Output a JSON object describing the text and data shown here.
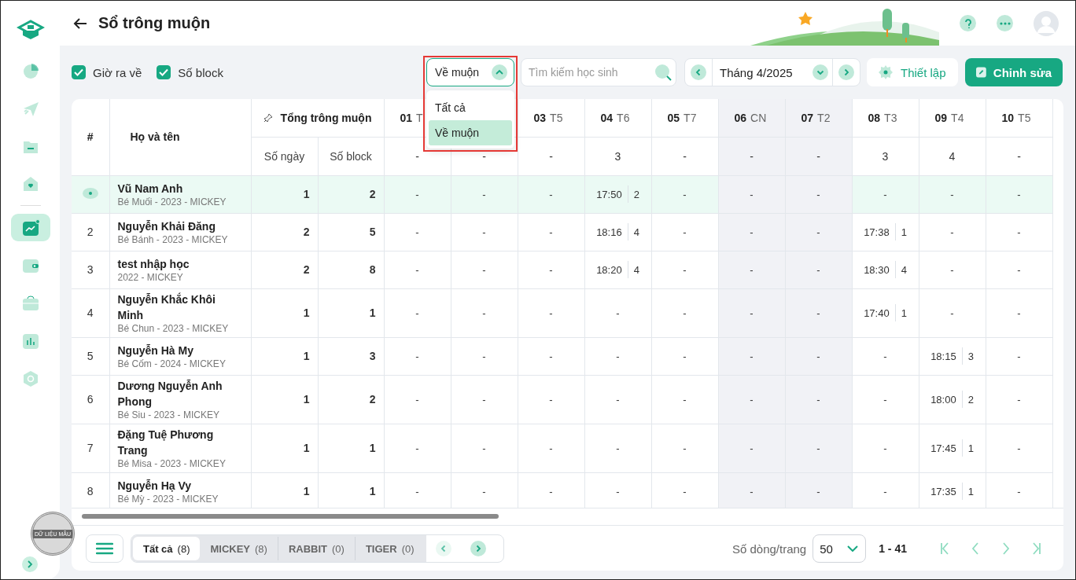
{
  "header": {
    "title": "Sổ trông muộn"
  },
  "sidebar": {
    "groups": [
      [
        {
          "selected": false
        },
        {
          "selected": false
        },
        {
          "selected": false
        },
        {
          "selected": false
        }
      ],
      [
        {
          "selected": true
        },
        {
          "selected": false
        },
        {
          "selected": false
        },
        {
          "selected": false
        },
        {
          "selected": false
        }
      ]
    ]
  },
  "stamp": {
    "text": "DỮ LIỆU MẪU"
  },
  "toolbar": {
    "options": [
      {
        "label": "Giờ ra về",
        "checked": true
      },
      {
        "label": "Số block",
        "checked": true
      }
    ],
    "filter": {
      "value": "Về muộn",
      "open": true,
      "highlighted": true,
      "options": [
        {
          "label": "Tất cả",
          "selected": false
        },
        {
          "label": "Về muộn",
          "selected": true
        }
      ]
    },
    "search": {
      "placeholder": "Tìm kiếm học sinh"
    },
    "month": {
      "label": "Tháng 4/2025"
    },
    "buttons": [
      {
        "label": "Thiết lập",
        "kind": "secondary"
      },
      {
        "label": "Chỉnh sửa",
        "kind": "primary"
      }
    ]
  },
  "table": {
    "columns": {
      "index": "#",
      "name": "Họ và tên",
      "total": "Tổng trông muộn",
      "days_count": "Số ngày",
      "blocks_count": "Số block"
    },
    "days": [
      {
        "day": "01",
        "weekday": "T",
        "off": false,
        "total": "-"
      },
      {
        "off": false,
        "total": "-"
      },
      {
        "day": "03",
        "weekday": "T5",
        "off": false,
        "total": "-"
      },
      {
        "day": "04",
        "weekday": "T6",
        "off": false,
        "total": "3"
      },
      {
        "day": "05",
        "weekday": "T7",
        "off": false,
        "total": "-"
      },
      {
        "day": "06",
        "weekday": "CN",
        "off": true,
        "total": "-"
      },
      {
        "day": "07",
        "weekday": "T2",
        "off": true,
        "total": "-"
      },
      {
        "day": "08",
        "weekday": "T3",
        "off": false,
        "total": "3"
      },
      {
        "day": "09",
        "weekday": "T4",
        "off": false,
        "total": "4"
      },
      {
        "day": "10",
        "weekday": "T5",
        "off": false,
        "total": "-"
      }
    ],
    "rows": [
      {
        "selected": true,
        "name": "Vũ Nam Anh",
        "info": "Bé Muối - 2023 - MICKEY",
        "days": "1",
        "blocks": "2",
        "cells": [
          {
            "kind": "empty",
            "text": "-"
          },
          {
            "kind": "empty",
            "text": "-"
          },
          {
            "kind": "empty",
            "text": "-"
          },
          {
            "kind": "late",
            "time": "17:50",
            "blocks": "2"
          },
          {
            "kind": "empty",
            "text": "-"
          },
          {
            "kind": "empty",
            "text": "-"
          },
          {
            "kind": "empty",
            "text": "-"
          },
          {
            "kind": "empty",
            "text": "-"
          },
          {
            "kind": "empty",
            "text": "-"
          },
          {
            "kind": "empty",
            "text": "-"
          }
        ]
      },
      {
        "selected": false,
        "index": "2",
        "name": "Nguyễn Khải Đăng",
        "info": "Bé Bánh - 2023 - MICKEY",
        "days": "2",
        "blocks": "5",
        "cells": [
          {
            "kind": "empty",
            "text": "-"
          },
          {
            "kind": "empty",
            "text": "-"
          },
          {
            "kind": "empty",
            "text": "-"
          },
          {
            "kind": "late",
            "time": "18:16",
            "blocks": "4"
          },
          {
            "kind": "empty",
            "text": "-"
          },
          {
            "kind": "empty",
            "text": "-"
          },
          {
            "kind": "empty",
            "text": "-"
          },
          {
            "kind": "late",
            "time": "17:38",
            "blocks": "1"
          },
          {
            "kind": "empty",
            "text": "-"
          },
          {
            "kind": "empty",
            "text": "-"
          }
        ]
      },
      {
        "selected": false,
        "index": "3",
        "name": "test nhập học",
        "info": "2022 - MICKEY",
        "days": "2",
        "blocks": "8",
        "cells": [
          {
            "kind": "empty",
            "text": "-"
          },
          {
            "kind": "empty",
            "text": "-"
          },
          {
            "kind": "empty",
            "text": "-"
          },
          {
            "kind": "late",
            "time": "18:20",
            "blocks": "4"
          },
          {
            "kind": "empty",
            "text": "-"
          },
          {
            "kind": "empty",
            "text": "-"
          },
          {
            "kind": "empty",
            "text": "-"
          },
          {
            "kind": "late",
            "time": "18:30",
            "blocks": "4"
          },
          {
            "kind": "empty",
            "text": "-"
          },
          {
            "kind": "empty",
            "text": "-"
          }
        ]
      },
      {
        "selected": false,
        "index": "4",
        "name": "Nguyễn Khắc Khôi Minh",
        "info": "Bé Chun - 2023 - MICKEY",
        "days": "1",
        "blocks": "1",
        "cells": [
          {
            "kind": "empty",
            "text": "-"
          },
          {
            "kind": "empty",
            "text": "-"
          },
          {
            "kind": "empty",
            "text": "-"
          },
          {
            "kind": "empty",
            "text": "-"
          },
          {
            "kind": "empty",
            "text": "-"
          },
          {
            "kind": "empty",
            "text": "-"
          },
          {
            "kind": "empty",
            "text": "-"
          },
          {
            "kind": "late",
            "time": "17:40",
            "blocks": "1"
          },
          {
            "kind": "empty",
            "text": "-"
          },
          {
            "kind": "empty",
            "text": "-"
          }
        ]
      },
      {
        "selected": false,
        "index": "5",
        "name": "Nguyễn Hà My",
        "info": "Bé Cốm - 2024 - MICKEY",
        "days": "1",
        "blocks": "3",
        "cells": [
          {
            "kind": "empty",
            "text": "-"
          },
          {
            "kind": "empty",
            "text": "-"
          },
          {
            "kind": "empty",
            "text": "-"
          },
          {
            "kind": "empty",
            "text": "-"
          },
          {
            "kind": "empty",
            "text": "-"
          },
          {
            "kind": "empty",
            "text": "-"
          },
          {
            "kind": "empty",
            "text": "-"
          },
          {
            "kind": "empty",
            "text": "-"
          },
          {
            "kind": "late",
            "time": "18:15",
            "blocks": "3"
          },
          {
            "kind": "empty",
            "text": "-"
          }
        ]
      },
      {
        "selected": false,
        "index": "6",
        "name": "Dương Nguyễn Anh Phong",
        "info": "Bé Siu - 2023 - MICKEY",
        "days": "1",
        "blocks": "2",
        "cells": [
          {
            "kind": "empty",
            "text": "-"
          },
          {
            "kind": "empty",
            "text": "-"
          },
          {
            "kind": "empty",
            "text": "-"
          },
          {
            "kind": "empty",
            "text": "-"
          },
          {
            "kind": "empty",
            "text": "-"
          },
          {
            "kind": "empty",
            "text": "-"
          },
          {
            "kind": "empty",
            "text": "-"
          },
          {
            "kind": "empty",
            "text": "-"
          },
          {
            "kind": "late",
            "time": "18:00",
            "blocks": "2"
          },
          {
            "kind": "empty",
            "text": "-"
          }
        ]
      },
      {
        "selected": false,
        "index": "7",
        "name": "Đặng Tuệ Phương Trang",
        "info": "Bé Misa - 2023 - MICKEY",
        "days": "1",
        "blocks": "1",
        "cells": [
          {
            "kind": "empty",
            "text": "-"
          },
          {
            "kind": "empty",
            "text": "-"
          },
          {
            "kind": "empty",
            "text": "-"
          },
          {
            "kind": "empty",
            "text": "-"
          },
          {
            "kind": "empty",
            "text": "-"
          },
          {
            "kind": "empty",
            "text": "-"
          },
          {
            "kind": "empty",
            "text": "-"
          },
          {
            "kind": "empty",
            "text": "-"
          },
          {
            "kind": "late",
            "time": "17:45",
            "blocks": "1"
          },
          {
            "kind": "empty",
            "text": "-"
          }
        ]
      },
      {
        "selected": false,
        "index": "8",
        "name": "Nguyễn Hạ Vy",
        "info": "Bé Mỳ - 2023 - MICKEY",
        "days": "1",
        "blocks": "1",
        "cells": [
          {
            "kind": "empty",
            "text": "-"
          },
          {
            "kind": "empty",
            "text": "-"
          },
          {
            "kind": "empty",
            "text": "-"
          },
          {
            "kind": "empty",
            "text": "-"
          },
          {
            "kind": "empty",
            "text": "-"
          },
          {
            "kind": "empty",
            "text": "-"
          },
          {
            "kind": "empty",
            "text": "-"
          },
          {
            "kind": "empty",
            "text": "-"
          },
          {
            "kind": "late",
            "time": "17:35",
            "blocks": "1"
          },
          {
            "kind": "empty",
            "text": "-"
          }
        ]
      }
    ]
  },
  "footer": {
    "groups": [
      {
        "label": "Tất cả",
        "count": "(8)",
        "selected": true
      },
      {
        "label": "MICKEY",
        "count": "(8)",
        "selected": false
      },
      {
        "label": "RABBIT",
        "count": "(0)",
        "selected": false
      },
      {
        "label": "TIGER",
        "count": "(0)",
        "selected": false
      }
    ],
    "group_prev_disabled": true,
    "group_next_disabled": false,
    "rows_label": "Số dòng/trang",
    "page_size": "50",
    "range": "1 - 41"
  }
}
